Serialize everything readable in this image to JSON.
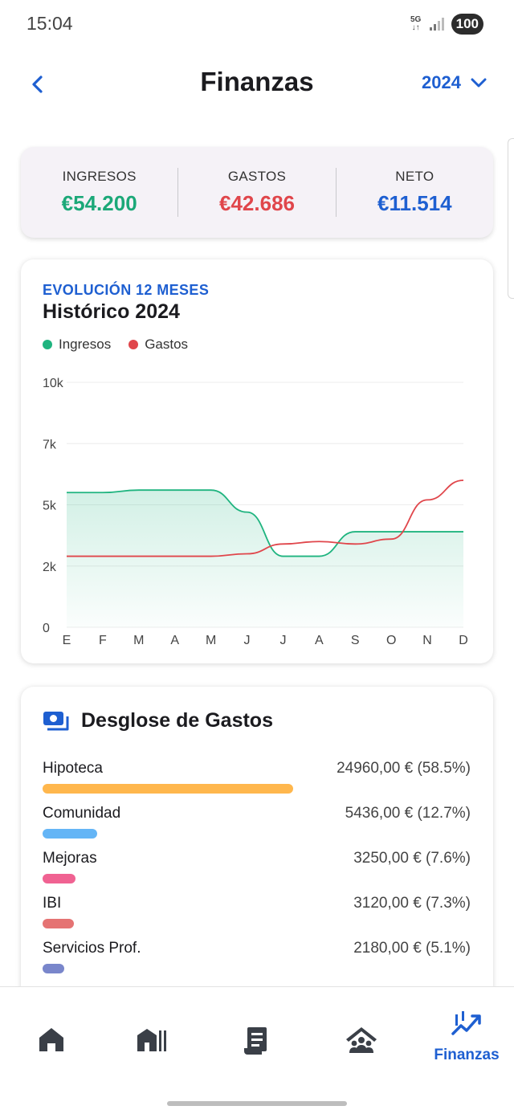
{
  "status": {
    "time": "15:04",
    "network": "5G",
    "battery": "100"
  },
  "header": {
    "title": "Finanzas",
    "year": "2024"
  },
  "summary": [
    {
      "label": "INGRESOS",
      "value": "€54.200",
      "color": "#1ba878"
    },
    {
      "label": "GASTOS",
      "value": "€42.686",
      "color": "#e0464b"
    },
    {
      "label": "NETO",
      "value": "€11.514",
      "color": "#1e5fd1"
    }
  ],
  "chart_card": {
    "kicker": "EVOLUCIÓN 12 MESES",
    "title": "Histórico 2024"
  },
  "chart_data": {
    "type": "line",
    "categories": [
      "E",
      "F",
      "M",
      "A",
      "M",
      "J",
      "J",
      "A",
      "S",
      "O",
      "N",
      "D"
    ],
    "series": [
      {
        "name": "Ingresos",
        "color": "#1fb47f",
        "fill": true,
        "values": [
          5500,
          5500,
          5600,
          5600,
          5600,
          4700,
          2900,
          2900,
          3900,
          3900,
          3900,
          3900
        ]
      },
      {
        "name": "Gastos",
        "color": "#e0464b",
        "fill": false,
        "values": [
          2900,
          2900,
          2900,
          2900,
          2900,
          3000,
          3400,
          3500,
          3400,
          3600,
          5200,
          6000
        ]
      }
    ],
    "y_ticks": [
      {
        "label": "0",
        "value": 0
      },
      {
        "label": "2k",
        "value": 2500
      },
      {
        "label": "5k",
        "value": 5000
      },
      {
        "label": "7k",
        "value": 7500
      },
      {
        "label": "10k",
        "value": 10000
      }
    ],
    "ylim": [
      0,
      10000
    ],
    "grid": true,
    "legend": "top-left"
  },
  "breakdown": {
    "title": "Desglose de Gastos",
    "items": [
      {
        "name": "Hipoteca",
        "value": "24960,00 € (58.5%)",
        "share": 0.585,
        "color": "#ffb74d"
      },
      {
        "name": "Comunidad",
        "value": "5436,00 € (12.7%)",
        "share": 0.127,
        "color": "#64b5f6"
      },
      {
        "name": "Mejoras",
        "value": "3250,00 € (7.6%)",
        "share": 0.076,
        "color": "#f06292"
      },
      {
        "name": "IBI",
        "value": "3120,00 € (7.3%)",
        "share": 0.073,
        "color": "#e57373"
      },
      {
        "name": "Servicios Prof.",
        "value": "2180,00 € (5.1%)",
        "share": 0.051,
        "color": "#7986cb"
      }
    ]
  },
  "nav": {
    "items": [
      {
        "icon": "home-icon"
      },
      {
        "icon": "buildings-icon"
      },
      {
        "icon": "receipt-icon"
      },
      {
        "icon": "community-icon"
      },
      {
        "icon": "trending-up-icon",
        "label": "Finanzas",
        "active": true
      }
    ]
  },
  "theme": {
    "accent": "#1e5fd1",
    "income": "#1ba878",
    "expense": "#e0464b"
  }
}
